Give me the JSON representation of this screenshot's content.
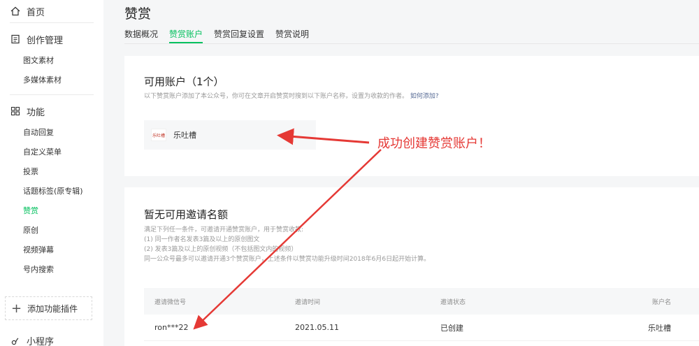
{
  "sidebar": {
    "home": "首页",
    "creation": {
      "title": "创作管理",
      "items": [
        "图文素材",
        "多媒体素材"
      ]
    },
    "features": {
      "title": "功能",
      "items": [
        "自动回复",
        "自定义菜单",
        "投票",
        "话题标签(原专辑)",
        "赞赏",
        "原创",
        "视频弹幕",
        "号内搜索"
      ],
      "active_index": 4
    },
    "add_plugin": "添加功能插件",
    "mini_program": "小程序"
  },
  "header": {
    "title": "赞赏",
    "tabs": [
      "数据概况",
      "赞赏账户",
      "赞赏回复设置",
      "赞赏说明"
    ],
    "active_tab": 1
  },
  "available": {
    "title": "可用账户（1个）",
    "desc": "以下赞赏账户添加了本公众号，你可在文章开启赞赏时搜到以下账户名称，设置为收款的作者。",
    "link": "如何添加?",
    "account_name": "乐吐槽",
    "logo_text": "乐吐槽"
  },
  "invites": {
    "title": "暂无可用邀请名额",
    "rules": [
      "满足下列任一条件，可邀请开通赞赏账户，用于赞赏收款:",
      "(1) 同一作者名发表3篇及以上的原创图文",
      "(2) 发表3篇及以上的原创视频（不包括图文内的视频）",
      "同一公众号最多可以邀请开通3个赞赏账户，上述条件以赞赏功能升级时间2018年6月6日起开始计算。"
    ],
    "columns": [
      "邀请微信号",
      "邀请时间",
      "邀请状态",
      "账户名"
    ],
    "rows": [
      {
        "wechat": "ron***22",
        "time": "2021.05.11",
        "status": "已创建",
        "account": "乐吐槽"
      }
    ]
  },
  "annotation": {
    "text": "成功创建赞赏账户！",
    "color": "#e53935"
  },
  "colors": {
    "accent": "#07c160",
    "link": "#576b95"
  }
}
